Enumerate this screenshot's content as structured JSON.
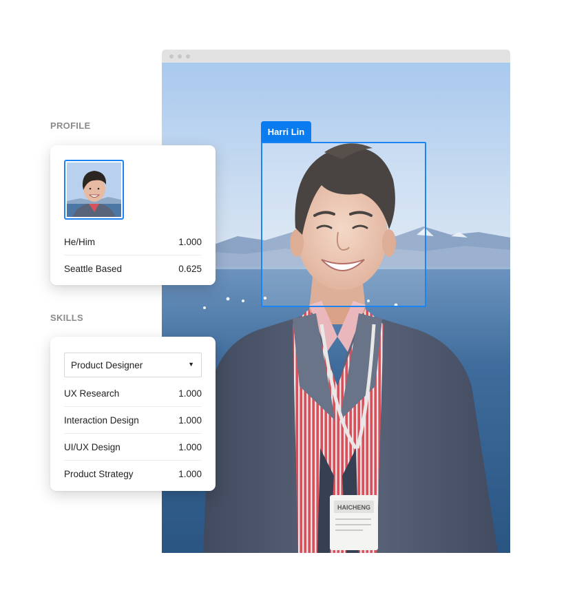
{
  "photo": {
    "detected_name": "Harri Lin",
    "badge_text": "HAICHENG"
  },
  "profile": {
    "heading": "PROFILE",
    "attributes": [
      {
        "label": "He/Him",
        "value": "1.000"
      },
      {
        "label": "Seattle Based",
        "value": "0.625"
      }
    ]
  },
  "skills": {
    "heading": "SKILLS",
    "selected_role": "Product Designer",
    "items": [
      {
        "label": "UX Research",
        "value": "1.000"
      },
      {
        "label": "Interaction Design",
        "value": "1.000"
      },
      {
        "label": "UI/UX Design",
        "value": "1.000"
      },
      {
        "label": "Product Strategy",
        "value": "1.000"
      }
    ]
  },
  "colors": {
    "accent": "#0b7cf0",
    "heading": "#8a8a8a",
    "text": "#1f1f1f",
    "window_chrome": "#e2e2e2"
  },
  "icons": {
    "dropdown": "caret-down-icon"
  }
}
